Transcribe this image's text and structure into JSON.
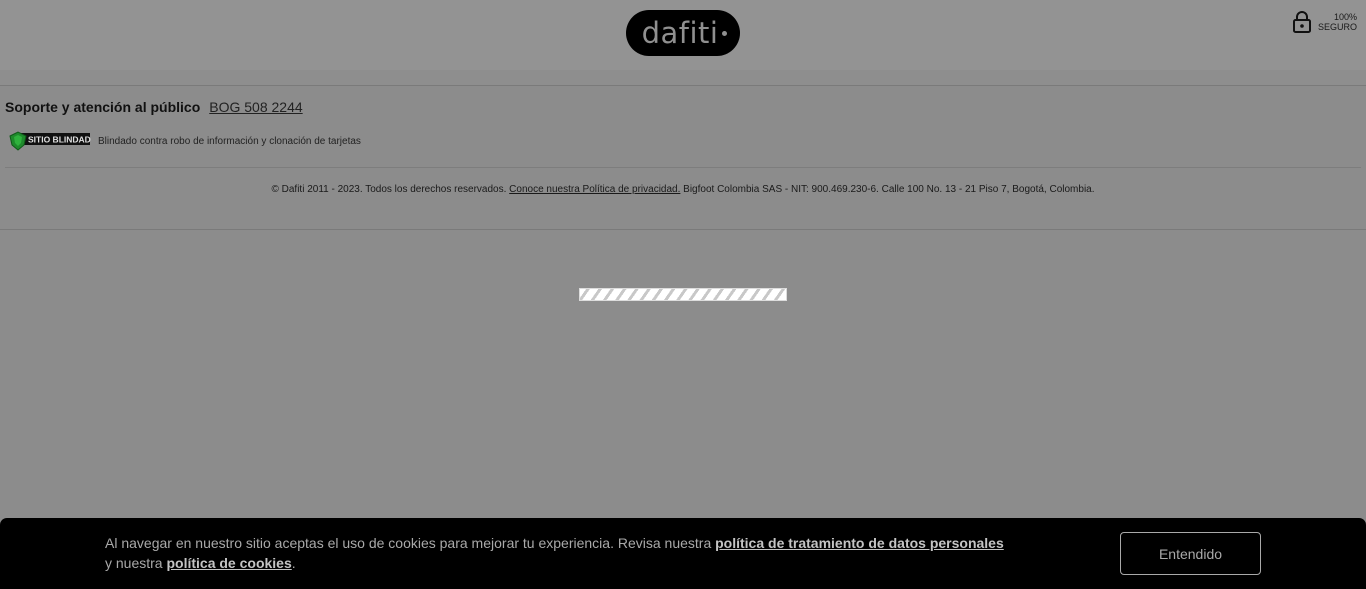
{
  "header": {
    "logo_text": "dafiti",
    "secure_line1": "100%",
    "secure_line2": "SEGURO",
    "lock_icon": "lock-icon"
  },
  "footer": {
    "support_label": "Soporte y atención al público",
    "support_phone": "BOG 508 2244",
    "shield_badge_text": "SITIO BLINDADO",
    "shield_description": "Blindado contra robo de información y clonación de tarjetas",
    "copyright_prefix": "© Dafiti 2011 - 2023. Todos los derechos reservados. ",
    "privacy_link": "Conoce nuestra Política de privacidad.",
    "copyright_suffix": " Bigfoot Colombia SAS - NIT: 900.469.230-6. Calle 100 No. 13 - 21 Piso 7, Bogotá, Colombia."
  },
  "loader": {
    "progress": 1.0
  },
  "cookie_banner": {
    "text_part1": "Al navegar en nuestro sitio aceptas el uso de cookies para mejorar tu experiencia. Revisa nuestra ",
    "link_data_policy": "política de tratamiento de datos personales",
    "text_part2": " y nuestra ",
    "link_cookie_policy": "política de cookies",
    "text_part3": ".",
    "accept_label": "Entendido"
  },
  "colors": {
    "overlay_background": "#8c8c8c",
    "banner_background": "#000000",
    "logo_background": "#000000",
    "shield_green": "#1f8a2c"
  }
}
